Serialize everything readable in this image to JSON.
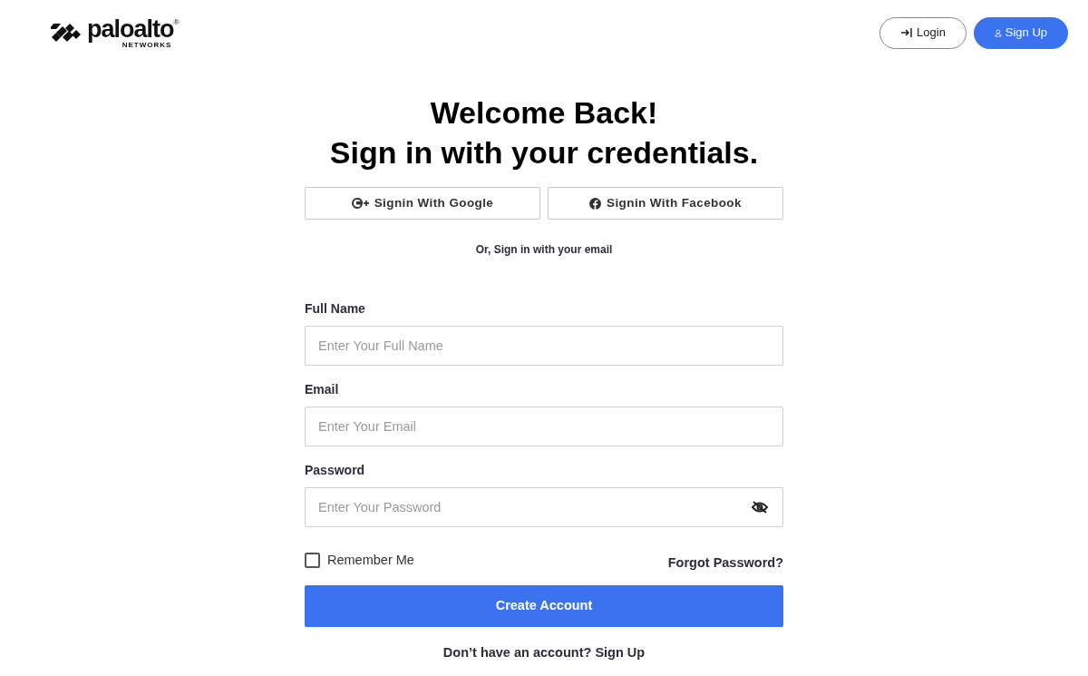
{
  "logo": {
    "wordmark": "paloalto",
    "registered": "®",
    "subtitle": "NETWORKS"
  },
  "header_buttons": [
    {
      "label": "Login",
      "kind": "outline"
    },
    {
      "label": "Sign Up",
      "kind": "primary"
    }
  ],
  "headings": [
    "Welcome Back!",
    "Sign in with your credentials."
  ],
  "social_buttons": [
    {
      "label": "Signin With Google",
      "kind": "google"
    },
    {
      "label": "Signin With Facebook",
      "kind": "facebook"
    }
  ],
  "divider_text": "Or, Sign in with your email",
  "fields": [
    {
      "label": "Full Name",
      "placeholder": "Enter Your Full Name",
      "kind": "text"
    },
    {
      "label": "Email",
      "placeholder": "Enter Your Email",
      "kind": "email"
    },
    {
      "label": "Password",
      "placeholder": "Enter Your Password",
      "kind": "password"
    }
  ],
  "remember_me": {
    "label": "Remember Me",
    "checked": false
  },
  "forgot_link": "Forgot Password?",
  "submit_button": "Create Account",
  "footer": {
    "prompt": "Don’t have an account?",
    "link": "Sign Up"
  }
}
